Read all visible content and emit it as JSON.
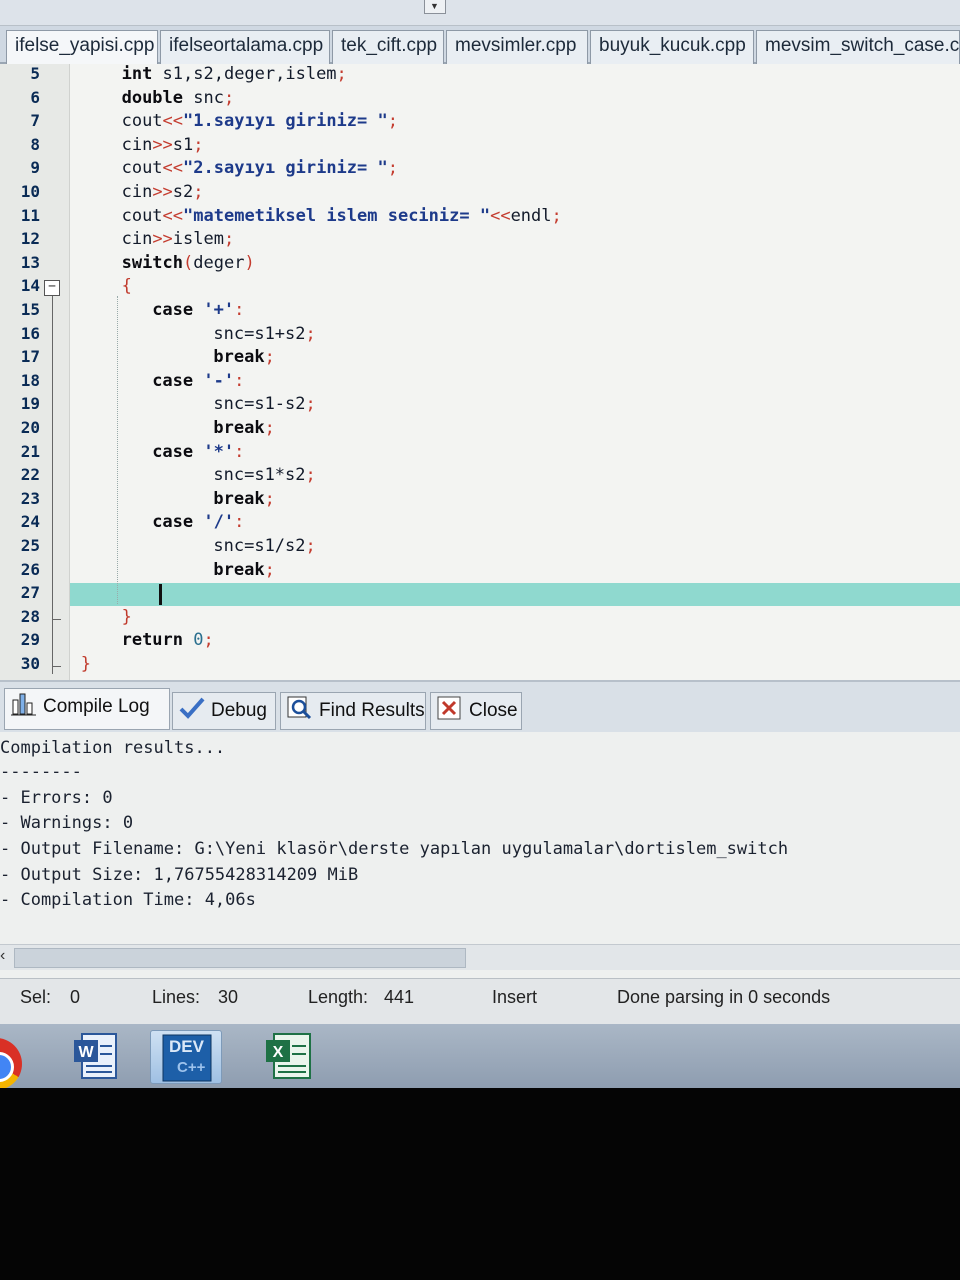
{
  "file_tabs": [
    {
      "label": "ifelse_yapisi.cpp"
    },
    {
      "label": "ifelseortalama.cpp"
    },
    {
      "label": "tek_cift.cpp"
    },
    {
      "label": "mevsimler.cpp"
    },
    {
      "label": "buyuk_kucuk.cpp"
    },
    {
      "label": "mevsim_switch_case.cpp"
    }
  ],
  "editor": {
    "line_numbers": [
      "5",
      "6",
      "7",
      "8",
      "9",
      "10",
      "11",
      "12",
      "13",
      "14",
      "15",
      "16",
      "17",
      "18",
      "19",
      "20",
      "21",
      "22",
      "23",
      "24",
      "25",
      "26",
      "27",
      "28",
      "29",
      "30"
    ],
    "lines": [
      {
        "indent": "        ",
        "parts": [
          [
            "kw",
            "int "
          ],
          [
            "",
            "s1,s2,deger,islem"
          ],
          [
            "op",
            ";"
          ]
        ]
      },
      {
        "indent": "        ",
        "parts": [
          [
            "kw",
            "double "
          ],
          [
            "",
            "snc"
          ],
          [
            "op",
            ";"
          ]
        ]
      },
      {
        "indent": "        ",
        "parts": [
          [
            "",
            "cout"
          ],
          [
            "op",
            "<<"
          ],
          [
            "str",
            "\"1.sayıyı giriniz= \""
          ],
          [
            "op",
            ";"
          ]
        ]
      },
      {
        "indent": "        ",
        "parts": [
          [
            "",
            "cin"
          ],
          [
            "op",
            ">>"
          ],
          [
            "",
            "s1"
          ],
          [
            "op",
            ";"
          ]
        ]
      },
      {
        "indent": "        ",
        "parts": [
          [
            "",
            "cout"
          ],
          [
            "op",
            "<<"
          ],
          [
            "str",
            "\"2.sayıyı giriniz= \""
          ],
          [
            "op",
            ";"
          ]
        ]
      },
      {
        "indent": "        ",
        "parts": [
          [
            "",
            "cin"
          ],
          [
            "op",
            ">>"
          ],
          [
            "",
            "s2"
          ],
          [
            "op",
            ";"
          ]
        ]
      },
      {
        "indent": "        ",
        "parts": [
          [
            "",
            "cout"
          ],
          [
            "op",
            "<<"
          ],
          [
            "str",
            "\"matemetiksel islem seciniz= \""
          ],
          [
            "op",
            "<<"
          ],
          [
            "",
            "endl"
          ],
          [
            "op",
            ";"
          ]
        ]
      },
      {
        "indent": "        ",
        "parts": [
          [
            "",
            "cin"
          ],
          [
            "op",
            ">>"
          ],
          [
            "",
            "islem"
          ],
          [
            "op",
            ";"
          ]
        ]
      },
      {
        "indent": "        ",
        "parts": [
          [
            "kw",
            "switch"
          ],
          [
            "op",
            "("
          ],
          [
            "",
            "deger"
          ],
          [
            "op",
            ")"
          ]
        ]
      },
      {
        "indent": "        ",
        "parts": [
          [
            "brace",
            "{"
          ]
        ]
      },
      {
        "indent": "           ",
        "parts": [
          [
            "kw",
            "case "
          ],
          [
            "str",
            "'+'"
          ],
          [
            "op",
            ":"
          ]
        ]
      },
      {
        "indent": "                 ",
        "parts": [
          [
            "",
            "snc=s1+s2"
          ],
          [
            "op",
            ";"
          ]
        ]
      },
      {
        "indent": "                 ",
        "parts": [
          [
            "kw",
            "break"
          ],
          [
            "op",
            ";"
          ]
        ]
      },
      {
        "indent": "           ",
        "parts": [
          [
            "kw",
            "case "
          ],
          [
            "str",
            "'-'"
          ],
          [
            "op",
            ":"
          ]
        ]
      },
      {
        "indent": "                 ",
        "parts": [
          [
            "",
            "snc=s1-s2"
          ],
          [
            "op",
            ";"
          ]
        ]
      },
      {
        "indent": "                 ",
        "parts": [
          [
            "kw",
            "break"
          ],
          [
            "op",
            ";"
          ]
        ]
      },
      {
        "indent": "           ",
        "parts": [
          [
            "kw",
            "case "
          ],
          [
            "str",
            "'*'"
          ],
          [
            "op",
            ":"
          ]
        ]
      },
      {
        "indent": "                 ",
        "parts": [
          [
            "",
            "snc=s1*s2"
          ],
          [
            "op",
            ";"
          ]
        ]
      },
      {
        "indent": "                 ",
        "parts": [
          [
            "kw",
            "break"
          ],
          [
            "op",
            ";"
          ]
        ]
      },
      {
        "indent": "           ",
        "parts": [
          [
            "kw",
            "case "
          ],
          [
            "str",
            "'/'"
          ],
          [
            "op",
            ":"
          ]
        ]
      },
      {
        "indent": "                 ",
        "parts": [
          [
            "",
            "snc=s1/s2"
          ],
          [
            "op",
            ";"
          ]
        ]
      },
      {
        "indent": "                 ",
        "parts": [
          [
            "kw",
            "break"
          ],
          [
            "op",
            ";"
          ]
        ]
      },
      {
        "indent": "",
        "parts": []
      },
      {
        "indent": "        ",
        "parts": [
          [
            "brace",
            "}"
          ]
        ]
      },
      {
        "indent": "        ",
        "parts": [
          [
            "kw",
            "return "
          ],
          [
            "num",
            "0"
          ],
          [
            "op",
            ";"
          ]
        ]
      },
      {
        "indent": "    ",
        "parts": [
          [
            "brace",
            "}"
          ]
        ]
      }
    ]
  },
  "panel_tabs": {
    "compile_log": "Compile Log",
    "debug": "Debug",
    "find_results": "Find Results",
    "close": "Close"
  },
  "log": {
    "lines": [
      "Compilation results...",
      "--------",
      "- Errors: 0",
      "- Warnings: 0",
      "- Output Filename: G:\\Yeni klasör\\derste yapılan uygulamalar\\dortislem_switch",
      "- Output Size: 1,76755428314209 MiB",
      "- Compilation Time: 4,06s"
    ]
  },
  "status": {
    "sel_label": "Sel:",
    "sel_value": "0",
    "lines_label": "Lines:",
    "lines_value": "30",
    "length_label": "Length:",
    "length_value": "441",
    "mode": "Insert",
    "parse_status": "Done parsing in 0 seconds"
  },
  "taskbar": {
    "icons": [
      "chrome-icon",
      "word-icon",
      "dev-cpp-icon",
      "excel-icon"
    ],
    "dev_label": "DEV",
    "dev_sub": "C++"
  },
  "colors": {
    "current_line": "#8fd9cf",
    "keyword": "#0b0b10",
    "operator": "#c43c2f",
    "string": "#1d3a8a"
  }
}
